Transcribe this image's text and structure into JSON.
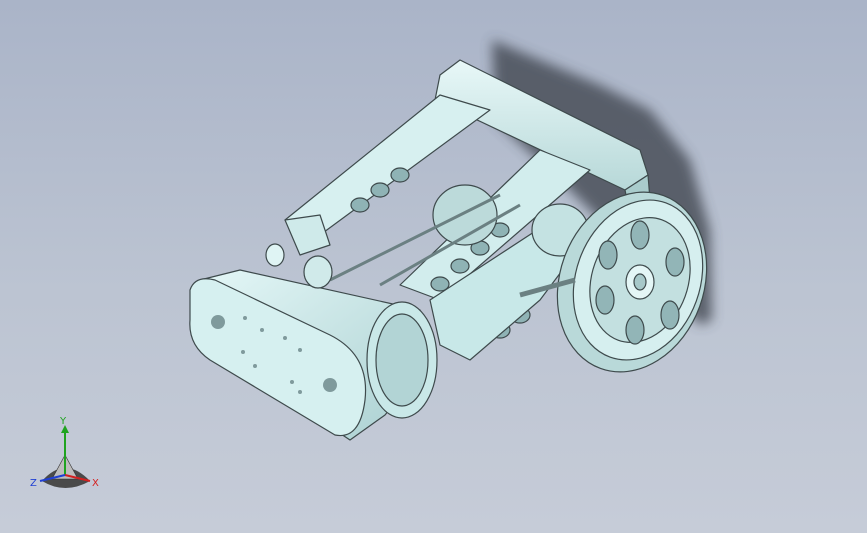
{
  "triad": {
    "x_label": "X",
    "y_label": "Y",
    "z_label": "Z",
    "x_color": "#d42020",
    "y_color": "#1fa31f",
    "z_color": "#1f3fd4"
  },
  "model": {
    "body_color": "#cfeeee",
    "shadow_color": "#3a3f48"
  }
}
